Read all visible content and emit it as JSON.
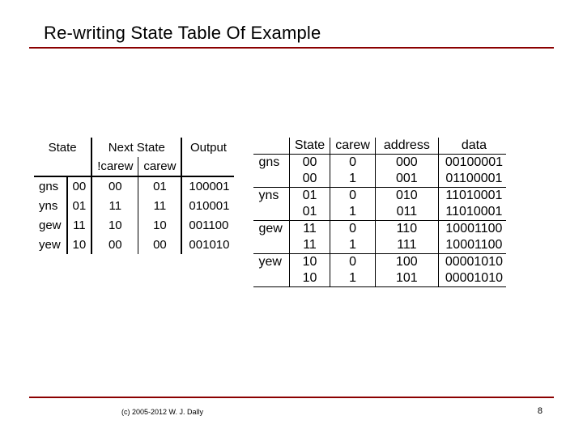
{
  "title": "Re-writing State Table Of Example",
  "left_table": {
    "headers1": {
      "state": "State",
      "next": "Next State",
      "output": "Output"
    },
    "headers2": {
      "ncarew": "!carew",
      "carew": "carew"
    },
    "rows": [
      {
        "name": "gns",
        "code": "00",
        "ncarew": "00",
        "carew": "01",
        "output": "100001"
      },
      {
        "name": "yns",
        "code": "01",
        "ncarew": "11",
        "carew": "11",
        "output": "010001"
      },
      {
        "name": "gew",
        "code": "11",
        "ncarew": "10",
        "carew": "10",
        "output": "001100"
      },
      {
        "name": "yew",
        "code": "10",
        "ncarew": "00",
        "carew": "00",
        "output": "001010"
      }
    ]
  },
  "right_table": {
    "headers": {
      "state": "State",
      "carew": "carew",
      "address": "address",
      "data": "data"
    },
    "rows": [
      {
        "name": "gns",
        "state": "00",
        "carew": "0",
        "address": "000",
        "data": "00100001"
      },
      {
        "name": "",
        "state": "00",
        "carew": "1",
        "address": "001",
        "data": "01100001"
      },
      {
        "name": "yns",
        "state": "01",
        "carew": "0",
        "address": "010",
        "data": "11010001"
      },
      {
        "name": "",
        "state": "01",
        "carew": "1",
        "address": "011",
        "data": "11010001"
      },
      {
        "name": "gew",
        "state": "11",
        "carew": "0",
        "address": "110",
        "data": "10001100"
      },
      {
        "name": "",
        "state": "11",
        "carew": "1",
        "address": "111",
        "data": "10001100"
      },
      {
        "name": "yew",
        "state": "10",
        "carew": "0",
        "address": "100",
        "data": "00001010"
      },
      {
        "name": "",
        "state": "10",
        "carew": "1",
        "address": "101",
        "data": "00001010"
      }
    ]
  },
  "footer": {
    "copyright": "(c) 2005-2012 W. J. Dally",
    "page": "8"
  }
}
